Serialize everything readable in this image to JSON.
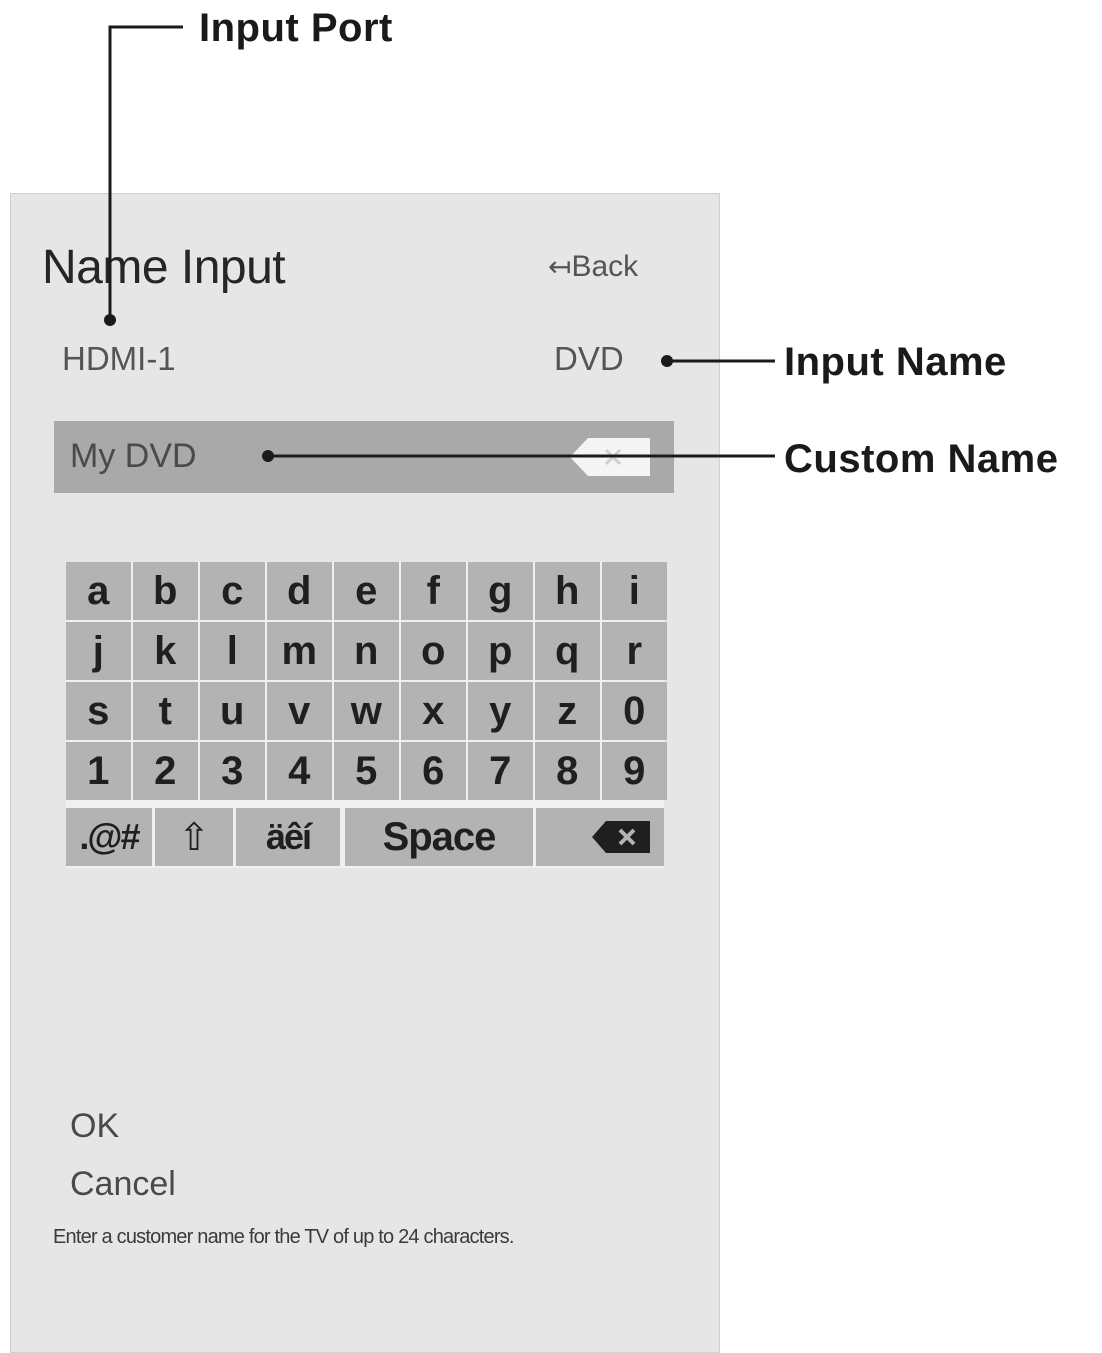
{
  "screen": {
    "title": "Name Input",
    "back_label": "Back",
    "back_arrow": "↤",
    "input_port": "HDMI-1",
    "input_name": "DVD",
    "custom_name_value": "My DVD",
    "keyboard": {
      "rows": [
        [
          "a",
          "b",
          "c",
          "d",
          "e",
          "f",
          "g",
          "h",
          "i"
        ],
        [
          "j",
          "k",
          "l",
          "m",
          "n",
          "o",
          "p",
          "q",
          "r"
        ],
        [
          "s",
          "t",
          "u",
          "v",
          "w",
          "x",
          "y",
          "z",
          "0"
        ],
        [
          "1",
          "2",
          "3",
          "4",
          "5",
          "6",
          "7",
          "8",
          "9"
        ]
      ],
      "bottom_row": {
        "symbols": ".@#",
        "shift": "⇧",
        "accents": "äêí",
        "space": "Space"
      }
    },
    "ok_label": "OK",
    "cancel_label": "Cancel",
    "help_text": "Enter a customer name for the TV of up to 24 characters."
  },
  "callouts": {
    "input_port": "Input Port",
    "input_name": "Input Name",
    "custom_name": "Custom Name"
  },
  "icons": {
    "back": "back-arrow-icon",
    "clear": "clear-field-icon",
    "shift": "shift-icon",
    "backspace": "backspace-icon"
  },
  "colors": {
    "panel": "#e6e6e6",
    "field": "#a9a9a9",
    "key": "#b3b3b3",
    "text": "#4a4a4a"
  }
}
